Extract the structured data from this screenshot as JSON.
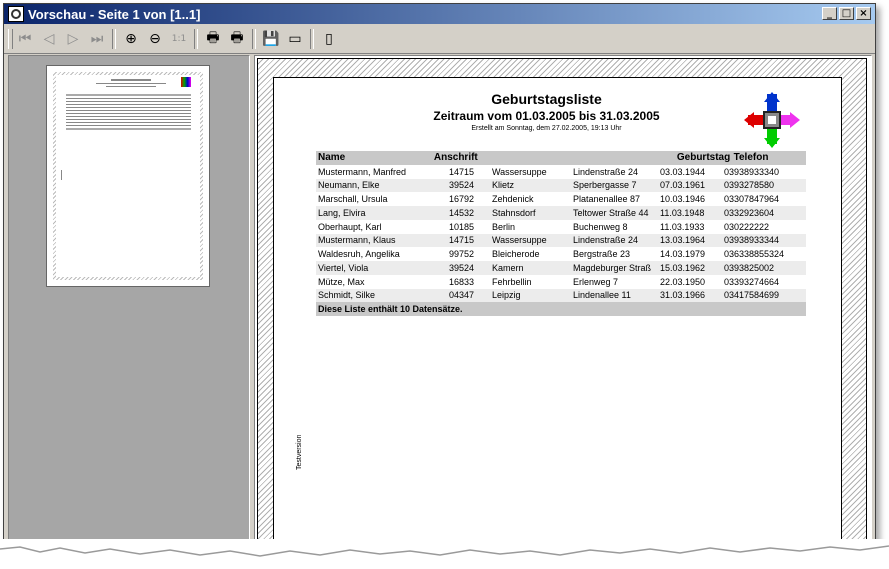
{
  "window": {
    "title": "Vorschau - Seite 1 von [1..1]"
  },
  "title_controls": {
    "minimize": "_",
    "maximize": "□",
    "close": "×"
  },
  "toolbar": {
    "first_page": "⏮",
    "prev_page": "◁",
    "next_page": "▷",
    "last_page": "⏭",
    "zoom_in": "⊕",
    "zoom_out": "⊖",
    "zoom_11": "1:1",
    "print": "🖶",
    "print_setup": "🖶",
    "save": "💾",
    "export": "▭",
    "close": "▯"
  },
  "report": {
    "title": "Geburtstagsliste",
    "subtitle": "Zeitraum vom 01.03.2005 bis 31.03.2005",
    "created": "Erstellt am Sonntag, dem 27.02.2005, 19:13 Uhr",
    "columns": {
      "name": "Name",
      "address": "Anschrift",
      "birthday": "Geburtstag",
      "phone": "Telefon"
    },
    "rows": [
      [
        "Mustermann, Manfred",
        "14715",
        "Wassersuppe",
        "Lindenstraße 24",
        "03.03.1944",
        "03938933340"
      ],
      [
        "Neumann, Elke",
        "39524",
        "Klietz",
        "Sperbergasse 7",
        "07.03.1961",
        "0393278580"
      ],
      [
        "Marschall, Ursula",
        "16792",
        "Zehdenick",
        "Platanenallee 87",
        "10.03.1946",
        "03307847964"
      ],
      [
        "Lang, Elvira",
        "14532",
        "Stahnsdorf",
        "Teltower Straße 44",
        "11.03.1948",
        "0332923604"
      ],
      [
        "Oberhaupt, Karl",
        "10185",
        "Berlin",
        "Buchenweg 8",
        "11.03.1933",
        "030222222"
      ],
      [
        "Mustermann, Klaus",
        "14715",
        "Wassersuppe",
        "Lindenstraße 24",
        "13.03.1964",
        "03938933344"
      ],
      [
        "Waldesruh, Angelika",
        "99752",
        "Bleicherode",
        "Bergstraße 23",
        "14.03.1979",
        "036338855324"
      ],
      [
        "Viertel, Viola",
        "39524",
        "Kamern",
        "Magdeburger Straß",
        "15.03.1962",
        "0393825002"
      ],
      [
        "Mütze, Max",
        "16833",
        "Fehrbellin",
        "Erlenweg 7",
        "22.03.1950",
        "03393274664"
      ],
      [
        "Schmidt, Silke",
        "04347",
        "Leipzig",
        "Lindenallee 11",
        "31.03.1966",
        "03417584699"
      ]
    ],
    "footer": "Diese Liste enthält 10 Datensätze.",
    "side_text": "Testversion"
  }
}
